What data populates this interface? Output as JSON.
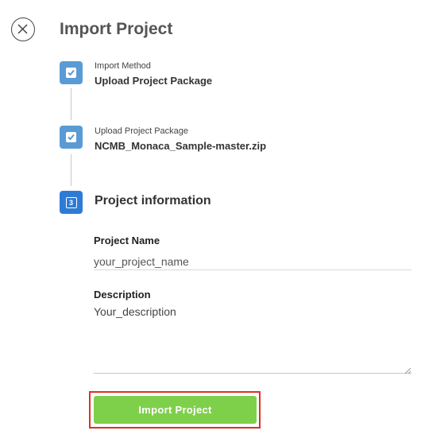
{
  "dialog": {
    "title": "Import Project"
  },
  "steps": [
    {
      "label": "Import Method",
      "value": "Upload Project Package",
      "status": "done"
    },
    {
      "label": "Upload Project Package",
      "value": "NCMB_Monaca_Sample-master.zip",
      "status": "done"
    },
    {
      "number": "3",
      "title": "Project information",
      "status": "current"
    }
  ],
  "form": {
    "project_name_label": "Project Name",
    "project_name_value": "your_project_name",
    "description_label": "Description",
    "description_value": "Your_description"
  },
  "actions": {
    "import_label": "Import Project"
  },
  "colors": {
    "step_done": "#5b9bd5",
    "step_current": "#2e7bd6",
    "import_button": "#7ed04b",
    "highlight": "#e03020"
  },
  "icons": {
    "close": "close-icon",
    "check": "checkbox-check-icon"
  }
}
